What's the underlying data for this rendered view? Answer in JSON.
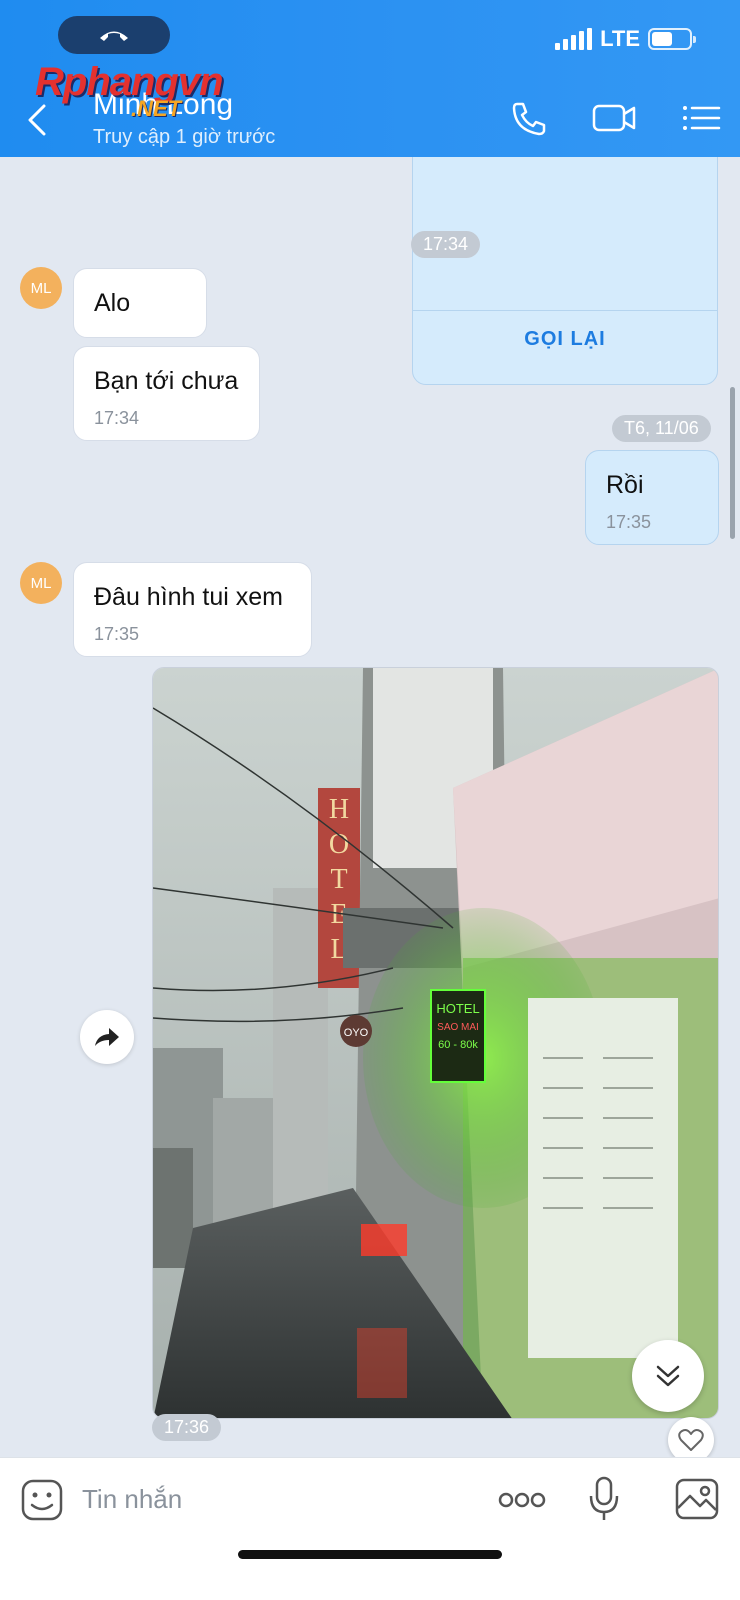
{
  "status_bar": {
    "network": "LTE"
  },
  "header": {
    "contact_name": "Minh Long",
    "last_seen": "Truy cập 1 giờ trước",
    "watermark_main": "Rphangvn",
    "watermark_sub": ".NET",
    "icons": [
      "back-icon",
      "phone-icon",
      "video-call-icon",
      "menu-icon"
    ]
  },
  "messages": [
    {
      "type": "call_card",
      "from": "me",
      "action": "GỌI LẠI",
      "time": "17:34"
    },
    {
      "type": "text",
      "from": "them",
      "avatar": "ML",
      "text": "Alo"
    },
    {
      "type": "text",
      "from": "them",
      "text": "Bạn tới chưa",
      "time": "17:34"
    },
    {
      "type": "date_divider",
      "text": "T6, 11/06"
    },
    {
      "type": "text",
      "from": "me",
      "text": "Rồi",
      "time": "17:35"
    },
    {
      "type": "text",
      "from": "them",
      "avatar": "ML",
      "text": "Đâu hình tui xem",
      "time": "17:35"
    },
    {
      "type": "image",
      "from": "me",
      "time": "17:36"
    }
  ],
  "input": {
    "placeholder": "Tin nhắn"
  },
  "colors": {
    "header": "#2b91f2",
    "chat_bg": "#e2e8f1",
    "my_bubble": "#d5ebfc",
    "accent": "#1d7ce0"
  }
}
